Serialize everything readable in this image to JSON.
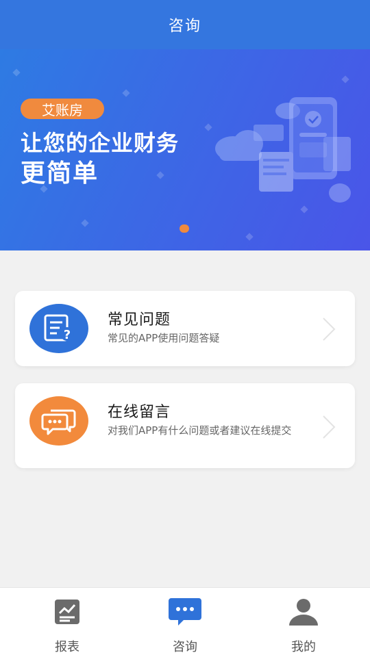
{
  "header": {
    "title": "咨询"
  },
  "banner": {
    "tag": "艾账房",
    "line1": "让您的企业财务",
    "line2": "更简单"
  },
  "cards": [
    {
      "title": "常见问题",
      "subtitle": "常见的APP使用问题答疑",
      "icon": "faq-list-icon"
    },
    {
      "title": "在线留言",
      "subtitle": "对我们APP有什么问题或者建议在线提交",
      "icon": "chat-bubbles-icon"
    }
  ],
  "tabs": [
    {
      "label": "报表",
      "icon": "report-chart-icon",
      "active": false
    },
    {
      "label": "咨询",
      "icon": "chat-message-icon",
      "active": true
    },
    {
      "label": "我的",
      "icon": "person-icon",
      "active": false
    }
  ],
  "colors": {
    "header": "#3476df",
    "accent_orange": "#f08a3e",
    "accent_blue": "#2f72d9"
  }
}
